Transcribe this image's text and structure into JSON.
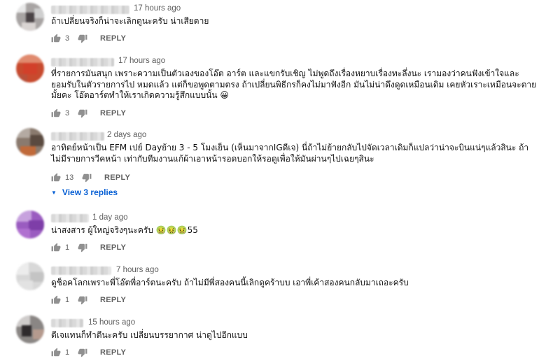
{
  "like_icon": "thumbs-up-icon",
  "dislike_icon": "thumbs-down-icon",
  "comments": [
    {
      "time": "17 hours ago",
      "text": "ถ้าเปลี่ยนจริงก็น่าจะเลิกดูนะครับ น่าเสียดาย",
      "likes": "3",
      "reply_label": "REPLY"
    },
    {
      "time": "17 hours ago",
      "text": "ที่รายการมันสนุก เพราะความเป็นตัวเองของโอ๊ต อาร์ต และแขกรับเชิญ ไม่พูดถึงเรื่องหยาบเรื่องทะลึ่งนะ เรามองว่าคนฟังเข้าใจและยอมรับในตัวรายการไป หมดแล้ว แต่ก็ขอพูดตามตรง ถ้าเปลี่ยนพิธีกรก็คงไม่มาฟังอีก มันไม่น่าดึงดูดเหมือนเดิม เคยหัวเราะเหมือนจะตายมั้ยคะ โอ๊ตอาร์ตทำให้เราเกิดความรู้สึกแบบนั้น 😀",
      "likes": "3",
      "reply_label": "REPLY"
    },
    {
      "time": "2 days ago",
      "text": "อาทิตย์หน้าเป็น EFM เปย์ Dayย้าย 3 - 5 โมงเย็น (เห็นมาจากIGดีเจ) นี่ถ้าไม่ย้ายกลับไปจัดเวลาเดิมก็แปลว่าน่าจะบินแน่ๆแล้วสินะ ถ้าไม่มีรายการวีคหน้า เท่ากับทีมงานแก้ผ้าเอาหน้ารอดบอกให้รอดูเพื่อให้มันผ่านๆไปเฉยๆสินะ",
      "likes": "13",
      "reply_label": "REPLY",
      "view_replies": "View 3 replies"
    },
    {
      "time": "1 day ago",
      "text": "น่าสงสาร ผู้ใหญ่จริงๆนะครับ 🤢🤢🤢55",
      "likes": "1",
      "reply_label": "REPLY"
    },
    {
      "time": "7 hours ago",
      "text": "ดูช็อคโลกเพราะพี่โอ๊ตพี่อาร์ตนะครับ ถ้าไม่มีพี่สองคนนี้เลิกดูคร้าบบ เอาพี่เค้าสองคนกลับมาเถอะครับ",
      "likes": "1",
      "reply_label": "REPLY"
    },
    {
      "time": "15 hours ago",
      "text": "ดีเจแทนก็ทำดีนะครับ เปลี่ยนบรรยากาศ น่าดูไปอีกแบบ",
      "likes": "1",
      "reply_label": "REPLY"
    }
  ]
}
